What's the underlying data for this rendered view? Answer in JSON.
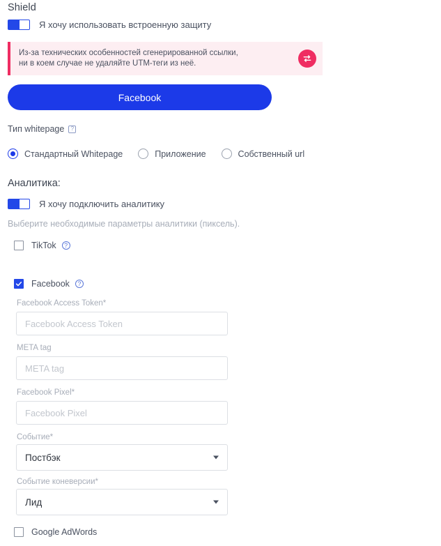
{
  "shield": {
    "title": "Shield",
    "toggle_label": "Я хочу использовать встроенную защиту",
    "toggle_on": true
  },
  "alert": {
    "text": "Из-за технических особенностей сгенерированной ссылки, ни в коем случае не удаляйте UTM-теги из неё.",
    "icon": "swap-arrows-icon",
    "bg_color": "#fdeef2",
    "accent_color": "#ef2d62"
  },
  "primary_button": {
    "label": "Facebook",
    "color": "#1c3ae8"
  },
  "whitepage": {
    "caption": "Тип whitepage",
    "help_icon": "question-mark-icon",
    "options": [
      {
        "label": "Стандартный Whitepage",
        "selected": true
      },
      {
        "label": "Приложение",
        "selected": false
      },
      {
        "label": "Собственный url",
        "selected": false
      }
    ]
  },
  "analytics": {
    "title": "Аналитика:",
    "toggle_label": "Я хочу подключить аналитику",
    "toggle_on": true,
    "hint": "Выберите необходимые параметры аналитики (пиксель).",
    "providers": [
      {
        "label": "TikTok",
        "checked": false,
        "help_icon": "question-mark-icon"
      },
      {
        "label": "Facebook",
        "checked": true,
        "help_icon": "question-mark-icon"
      },
      {
        "label": "Google AdWords",
        "checked": false
      }
    ]
  },
  "facebook_form": {
    "access_token": {
      "label": "Facebook Access Token*",
      "placeholder": "Facebook Access Token",
      "value": ""
    },
    "meta_tag": {
      "label": "META tag",
      "placeholder": "META tag",
      "value": ""
    },
    "pixel": {
      "label": "Facebook Pixel*",
      "placeholder": "Facebook Pixel",
      "value": ""
    },
    "event": {
      "label": "Событие*",
      "value": "Постбэк"
    },
    "conversion_event": {
      "label": "Событие коневерсии*",
      "value": "Лид"
    }
  }
}
